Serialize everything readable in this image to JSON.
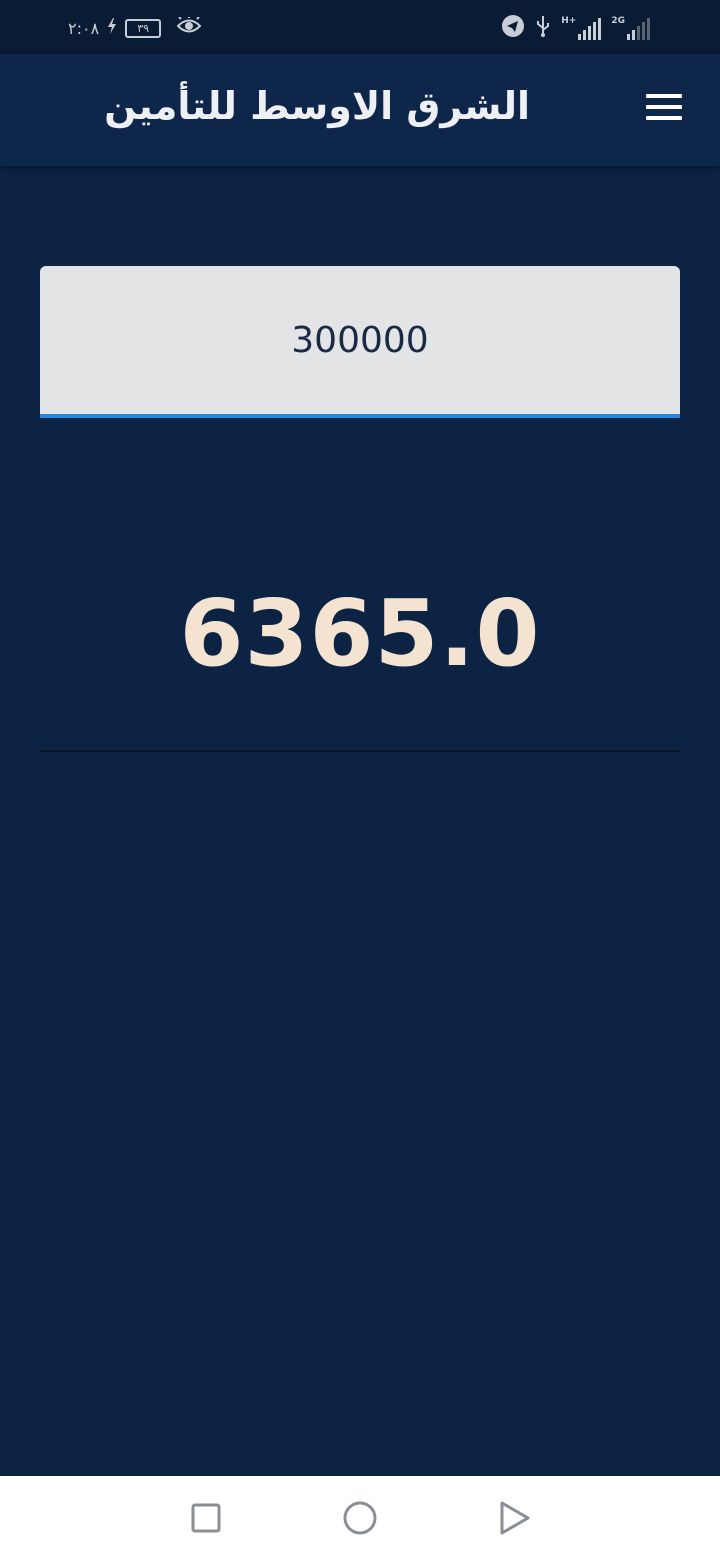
{
  "status_bar": {
    "time": "٢:٠٨",
    "battery": "٣٩",
    "network_type": "H+",
    "network_type_2": "2G",
    "icons": [
      "eye-icon",
      "charging-icon",
      "battery-icon",
      "signal-icon",
      "usb-icon",
      "telegram-icon"
    ]
  },
  "app_bar": {
    "title": "الشرق الاوسط للتأمين",
    "menu_icon": "hamburger-menu-icon"
  },
  "main": {
    "amount_value": "300000",
    "result": "6365.0"
  },
  "nav_bar": {
    "icons": [
      "recents-square-icon",
      "home-circle-icon",
      "back-triangle-icon"
    ]
  },
  "colors": {
    "background": "#0c2344",
    "app_bar": "#0d264a",
    "input_underline": "#2a88e0",
    "result_text": "#f3e3d0"
  }
}
